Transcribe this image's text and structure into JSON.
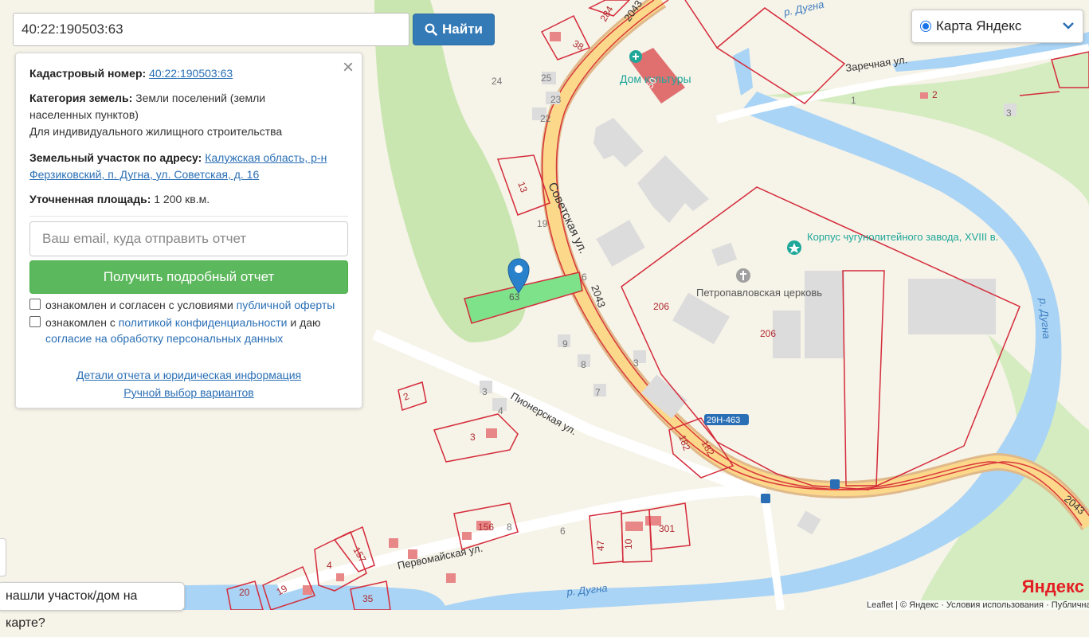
{
  "search": {
    "value": "40:22:190503:63",
    "button_label": "Найти"
  },
  "layer": {
    "selected": "Карта Яндекс"
  },
  "info": {
    "cadastral_label": "Кадастровый номер:",
    "cadastral_value": "40:22:190503:63",
    "category_label": "Категория земель:",
    "category_value": "Земли поселений (земли населенных пунктов)",
    "usage": "Для индивидуального жилищного строительства",
    "address_label": "Земельный участок по адресу:",
    "address_value": "Калужская область, р-н Ферзиковский, п. Дугна, ул. Советская, д. 16",
    "area_label": "Уточненная площадь:",
    "area_value": "1 200 кв.м.",
    "email_placeholder": "Ваш email, куда отправить отчет",
    "report_button": "Получить подробный отчет",
    "check1_text": "ознакомлен и согласен с условиями",
    "check1_link": "публичной оферты",
    "check2_text": "ознакомлен с",
    "check2_link": "политикой конфиденциальности",
    "check2_text2": "и даю",
    "check2_link2": "согласие на обработку персональных данных",
    "details_link": "Детали отчета и юридическая информация",
    "manual_link": "Ручной выбор вариантов"
  },
  "help_button": "нашли участок/дом на карте?",
  "attribution": "Leaflet | © Яндекс · Условия использования · Публичная кадастровая карта",
  "yandex_logo": "Яндекс",
  "map_labels": {
    "street_sovetskaya": "Советская ул.",
    "street_pionerskaya": "Пионерская ул.",
    "street_pervomayskaya": "Первомайская ул.",
    "street_zarechnaya": "Заречная ул.",
    "river1": "р. Дугна",
    "river2": "р. Дугна",
    "river3": "р. Дугна",
    "poi_dom": "Дом культуры",
    "poi_korpus": "Корпус чугунолитейного завода, XVIII в.",
    "poi_church": "Петропавловская церковь",
    "road_2043a": "2043",
    "road_2043b": "2043",
    "road_2043c": "2043",
    "road_29n": "29Н-463",
    "n_63": "63",
    "n_13": "13",
    "n_19": "19",
    "n_206a": "206",
    "n_206b": "206",
    "n_182a": "182",
    "n_182b": "182",
    "n_156": "156",
    "n_301": "301",
    "n_47": "47",
    "n_10": "10",
    "n_157": "157",
    "n_4": "4",
    "n_19b": "19",
    "n_35": "35",
    "n_2": "2",
    "n_3": "3",
    "n_50": "50",
    "n_38": "38",
    "n_284": "284",
    "n_24": "24",
    "n_25": "25",
    "n_23": "23",
    "n_22": "22",
    "n_1": "1",
    "n_2b": "2",
    "n_3b": "3",
    "n_9": "9",
    "n_8": "8",
    "n_7": "7",
    "n_3c": "3",
    "n_4b": "4",
    "n_6": "6",
    "n_6b": "6",
    "n_8b": "8",
    "n_3d": "3",
    "n_20": "20"
  }
}
